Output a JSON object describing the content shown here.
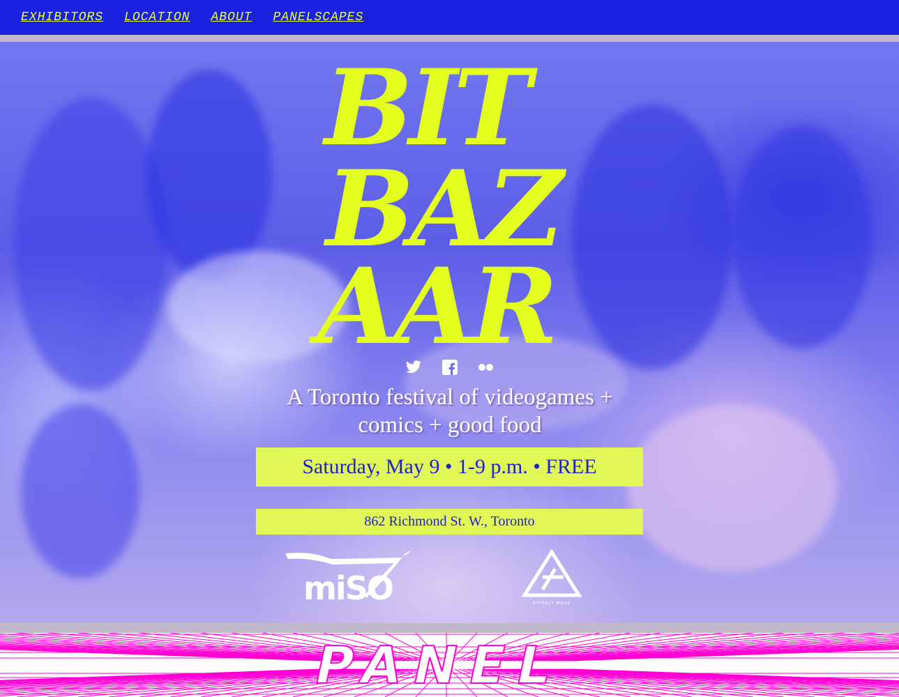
{
  "nav": {
    "items": [
      {
        "label": "EXHIBITORS"
      },
      {
        "label": "LOCATION"
      },
      {
        "label": "ABOUT"
      },
      {
        "label": "PANELSCAPES"
      }
    ]
  },
  "hero": {
    "title_lines": [
      "BIT",
      "BAZ",
      "AAR"
    ],
    "social_icons": [
      "twitter-icon",
      "facebook-icon",
      "flickr-icon"
    ],
    "tagline": "A Toronto festival of videogames + comics + good food",
    "date_line": "Saturday, May 9 • 1-9 p.m. • FREE",
    "address": "862 Richmond St. W., Toronto",
    "logos": {
      "miso": "miSO",
      "attract_mode": "ATTRACT MODE"
    }
  },
  "panel": {
    "label": "PANEL"
  },
  "colors": {
    "nav_bg": "#1a22e0",
    "accent_yellow": "#e4ff1e",
    "box_bg": "#e0f755",
    "box_text": "#1f1fce",
    "panel_lines": "#ff00d4"
  }
}
